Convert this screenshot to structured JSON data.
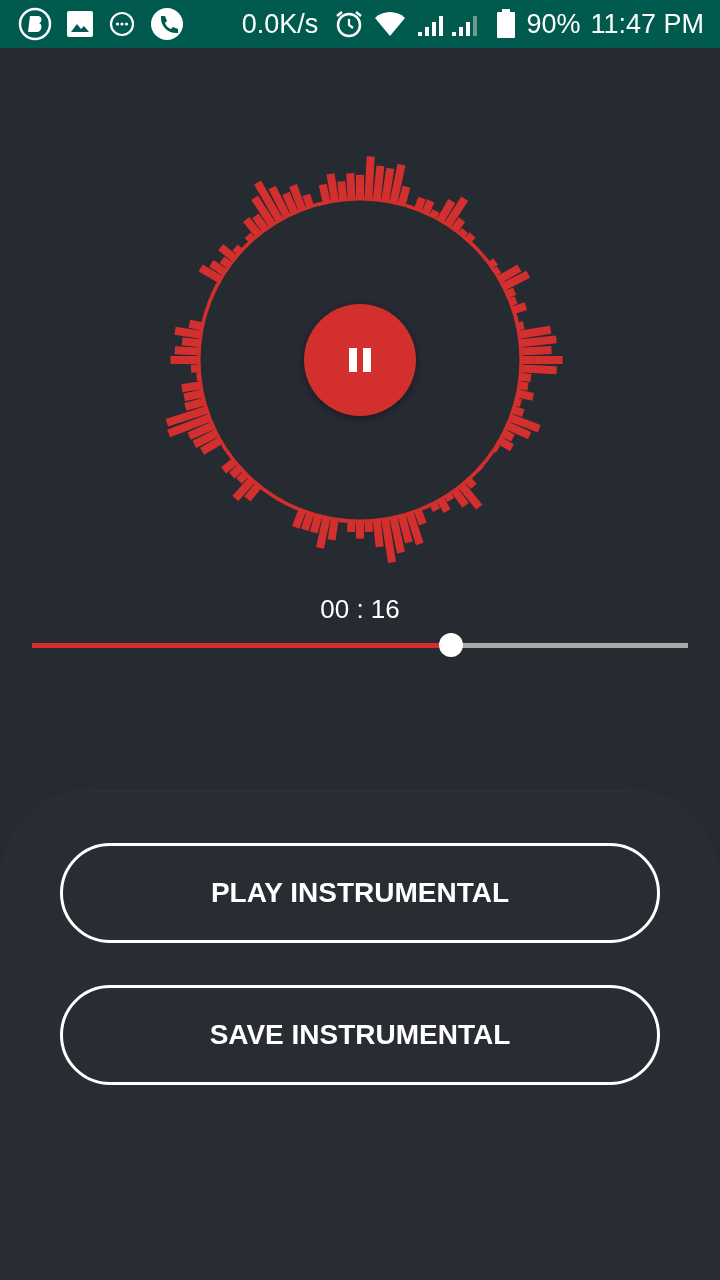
{
  "status_bar": {
    "net_speed": "0.0K/s",
    "battery": "90%",
    "time": "11:47 PM"
  },
  "player": {
    "playing": true,
    "elapsed": "00 : 16",
    "level": 0.634
  },
  "buttons": [
    {
      "label": "PLAY INSTRUMENTAL"
    },
    {
      "label": "SAVE INSTRUMENTAL"
    }
  ]
}
